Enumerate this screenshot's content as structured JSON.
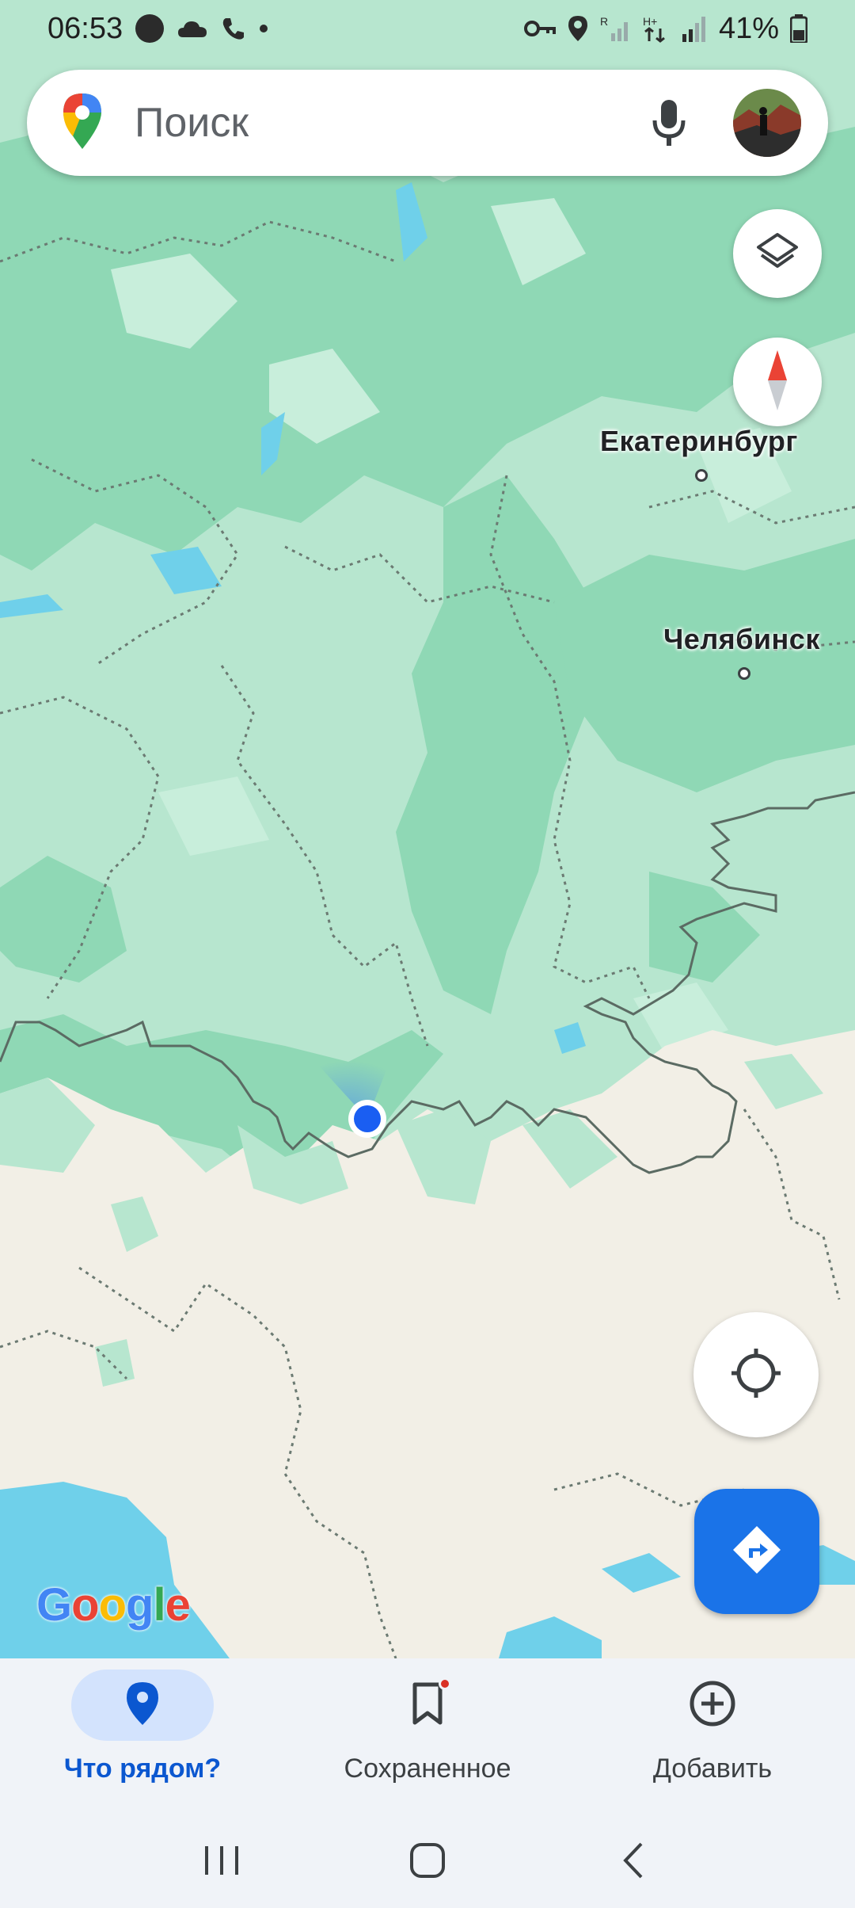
{
  "status_bar": {
    "time": "06:53",
    "battery": "41%"
  },
  "search": {
    "placeholder": "Поиск"
  },
  "map": {
    "cities": [
      {
        "name": "Екатеринбург"
      },
      {
        "name": "Челябинск"
      }
    ],
    "attribution": "Google"
  },
  "bottom_nav": {
    "items": [
      {
        "label": "Что рядом?",
        "icon": "location-pin-icon",
        "active": true
      },
      {
        "label": "Сохраненное",
        "icon": "bookmark-icon",
        "active": false,
        "badge": true
      },
      {
        "label": "Добавить",
        "icon": "add-circle-icon",
        "active": false
      }
    ]
  },
  "colors": {
    "accent": "#1a73e8",
    "nav_active": "#0b57d0",
    "forest": "#8fd8b5",
    "land": "#b7e6cf",
    "steppe": "#f2efe6",
    "water": "#6fd0ea"
  }
}
